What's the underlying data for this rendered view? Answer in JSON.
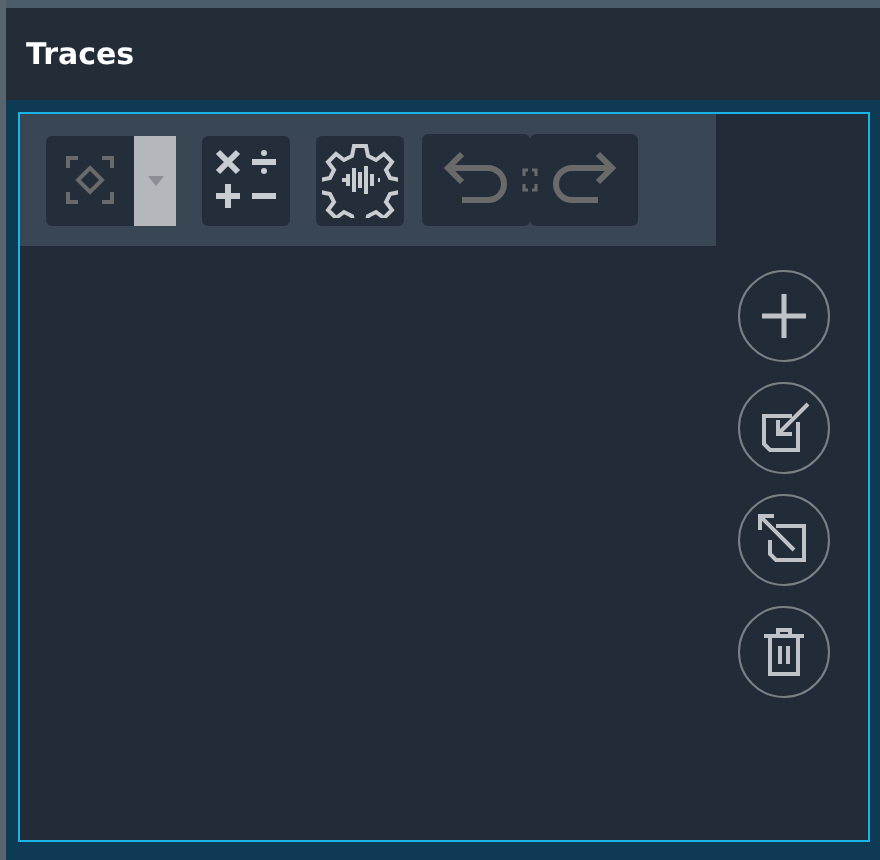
{
  "panel": {
    "title": "Traces"
  },
  "toolbar": [
    {
      "kind": "select",
      "disabled": true
    },
    {
      "kind": "math",
      "disabled": false
    },
    {
      "kind": "gear",
      "disabled": false
    },
    {
      "kind": "undo",
      "disabled": true
    },
    {
      "kind": "redo",
      "disabled": true
    }
  ],
  "side_buttons": [
    {
      "kind": "add"
    },
    {
      "kind": "import"
    },
    {
      "kind": "export"
    },
    {
      "kind": "delete"
    }
  ]
}
